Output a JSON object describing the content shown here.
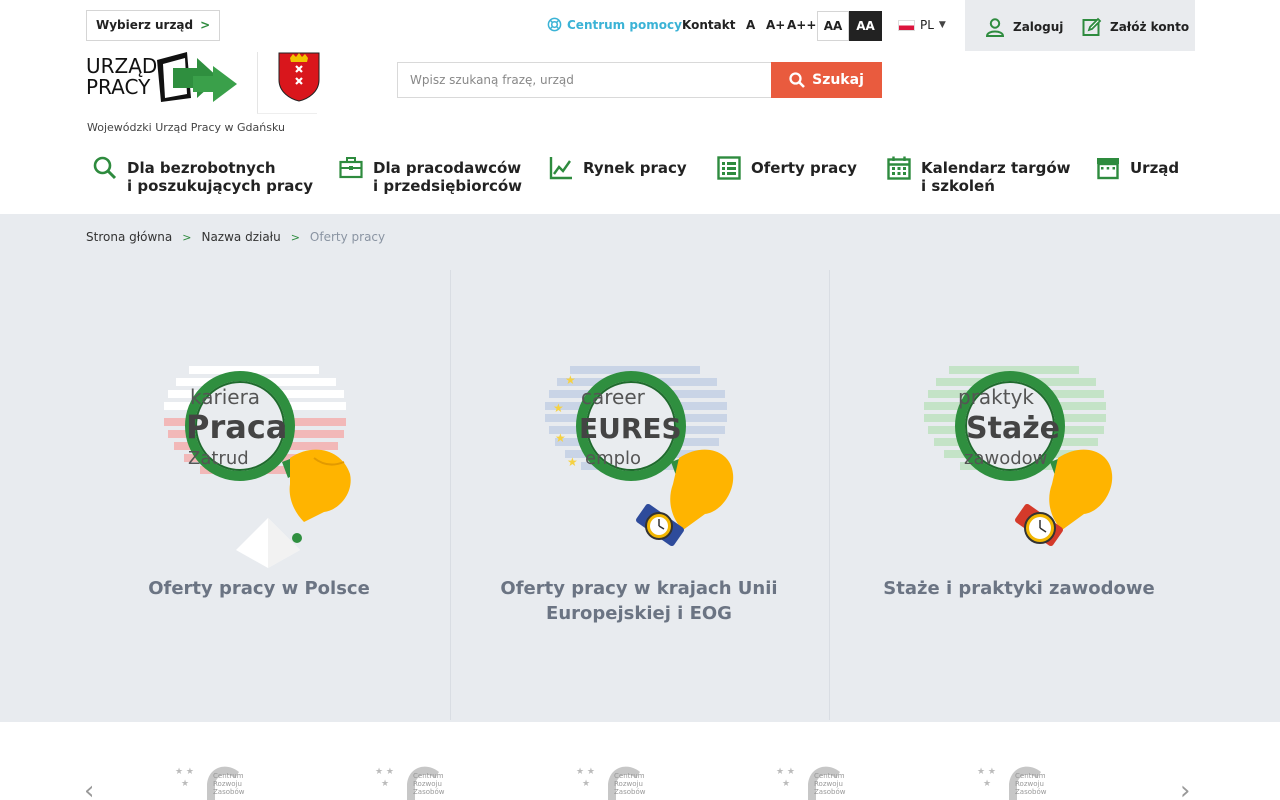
{
  "topbar": {
    "select_office": "Wybierz urząd",
    "help": "Centrum pomocy",
    "contact": "Kontakt",
    "font_sizes": [
      "A",
      "A+",
      "A++"
    ],
    "contrast_normal": "AA",
    "contrast_high": "AA",
    "language": "PL",
    "login": "Zaloguj",
    "register": "Załóż konto"
  },
  "logo": {
    "line1": "URZĄD",
    "line2": "PRACY",
    "subtitle": "Wojewódzki Urząd Pracy w Gdańsku"
  },
  "search": {
    "placeholder": "Wpisz szukaną frazę, urząd",
    "button": "Szukaj"
  },
  "nav": [
    {
      "label": "Dla bezrobotnych\ni poszukujących pracy",
      "icon": "search-icon"
    },
    {
      "label": "Dla pracodawców\ni przedsiębiorców",
      "icon": "briefcase-icon"
    },
    {
      "label": "Rynek pracy",
      "icon": "chart-icon"
    },
    {
      "label": "Oferty pracy",
      "icon": "list-icon"
    },
    {
      "label": "Kalendarz targów\ni szkoleń",
      "icon": "calendar-icon"
    },
    {
      "label": "Urząd",
      "icon": "building-icon"
    }
  ],
  "breadcrumb": [
    "Strona główna",
    "Nazwa działu",
    "Oferty pracy"
  ],
  "cards": [
    {
      "title": "Oferty pracy w Polsce",
      "word_top": "kariera",
      "word_main": "Praca",
      "word_bottom": "Zatrud"
    },
    {
      "title": "Oferty pracy w krajach Unii Europejskiej i EOG",
      "word_top": "career",
      "word_main": "EURES",
      "word_bottom": "emplo"
    },
    {
      "title": "Staże i praktyki zawodowe",
      "word_top": "praktyk",
      "word_main": "Staże",
      "word_bottom": "zawodow"
    }
  ],
  "partners": {
    "logo_text": [
      "Centrum",
      "Rozwoju",
      "Zasobów"
    ]
  },
  "colors": {
    "accent_green": "#2e8b3e",
    "search_red": "#e95b3e",
    "help_blue": "#3bb3d6",
    "grey_bg": "#e8ebef",
    "card_title": "#6b7483"
  }
}
